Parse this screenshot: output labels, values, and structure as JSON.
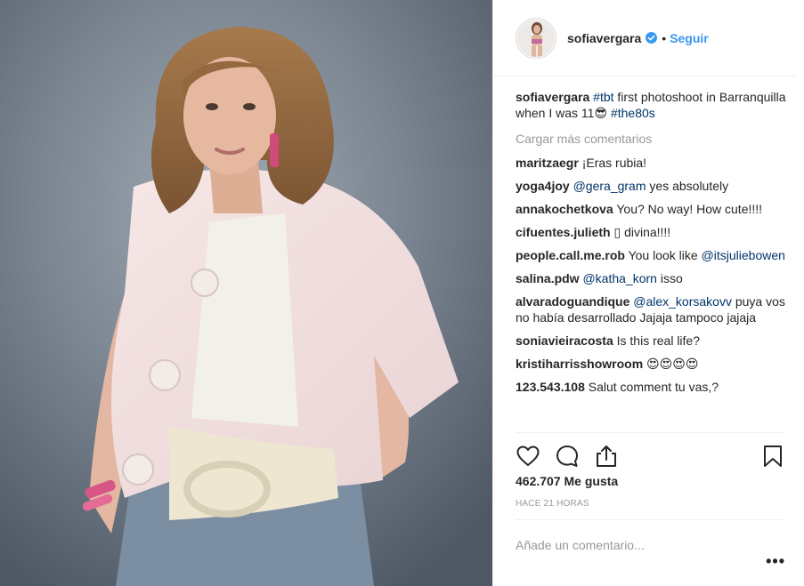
{
  "post": {
    "username": "sofiavergara",
    "separator": "•",
    "follow_label": "Seguir",
    "caption": {
      "user": "sofiavergara",
      "tag1": "#tbt",
      "text1": " first photoshoot in Barranquilla when I was 11",
      "emoji": "😎",
      "tag2": "#the80s"
    },
    "load_more": "Cargar más comentarios",
    "comments": [
      {
        "user": "maritzaegr",
        "text": "¡Eras rubia!"
      },
      {
        "user": "yoga4joy",
        "mention": "@gera_gram",
        "text": " yes absolutely"
      },
      {
        "user": "annakochetkova",
        "text": "You? No way! How cute!!!!"
      },
      {
        "user": "cifuentes.julieth",
        "text": "▯ divina!!!!"
      },
      {
        "user": "people.call.me.rob",
        "text": "You look like ",
        "mention": "@itsjuliebowen"
      },
      {
        "user": "salina.pdw",
        "mention": "@katha_korn",
        "text": " isso"
      },
      {
        "user": "alvaradoguandique",
        "mention": "@alex_korsakovv",
        "text": " puya vos no había desarrollado Jajaja tampoco jajaja"
      },
      {
        "user": "soniavieiracosta",
        "text": "Is this real life?"
      },
      {
        "user": "kristiharrisshowroom",
        "text": "😍😍😍😍"
      },
      {
        "user": "123.543.108",
        "text": "Salut comment tu vas,?"
      }
    ],
    "likes": "462.707 Me gusta",
    "time": "HACE 21 HORAS",
    "add_comment_placeholder": "Añade un comentario...",
    "more_options": "•••"
  },
  "icons": {
    "like": "heart-icon",
    "comment": "comment-icon",
    "share": "share-icon",
    "save": "bookmark-icon",
    "verified": "verified-badge-icon"
  },
  "colors": {
    "link": "#3897f0",
    "tag": "#003569",
    "muted": "#999999",
    "text": "#262626",
    "border": "#efefef"
  }
}
